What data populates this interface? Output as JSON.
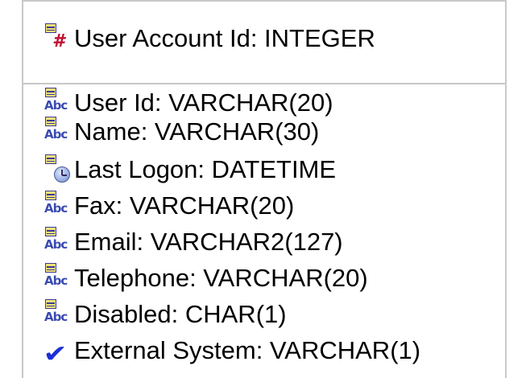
{
  "entity": {
    "primary_key": {
      "label": "User Account Id: INTEGER",
      "icon": "primary-key-hash-icon"
    },
    "attributes": [
      {
        "label": "User Id: VARCHAR(20)",
        "icon": "string-column-icon"
      },
      {
        "label": "Name: VARCHAR(30)",
        "icon": "string-column-icon"
      },
      {
        "label": "Last Logon: DATETIME",
        "icon": "datetime-column-icon"
      },
      {
        "label": "Fax: VARCHAR(20)",
        "icon": "string-column-icon"
      },
      {
        "label": "Email: VARCHAR2(127)",
        "icon": "string-column-icon"
      },
      {
        "label": "Telephone: VARCHAR(20)",
        "icon": "string-column-icon"
      },
      {
        "label": "Disabled: CHAR(1)",
        "icon": "string-column-icon"
      },
      {
        "label": "External System: VARCHAR(1)",
        "icon": "checkmark-icon"
      }
    ]
  },
  "colors": {
    "border": "#c8c8c8",
    "icon_blue": "#3b4bb0",
    "icon_red": "#c01030",
    "table_yellow": "#f2e27a"
  }
}
